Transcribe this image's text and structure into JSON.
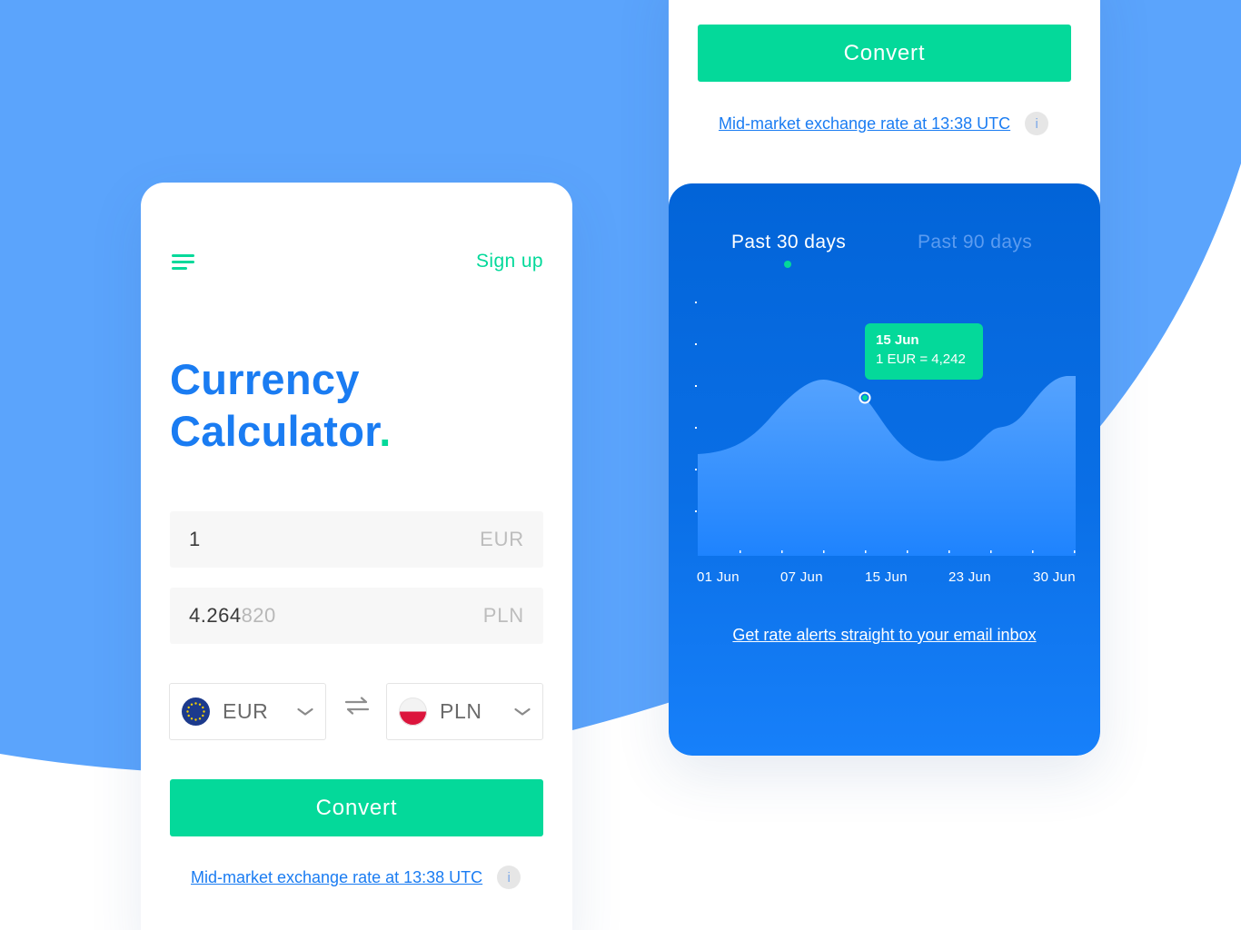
{
  "theme": {
    "accent_green": "#04d99a",
    "brand_blue": "#1a7cf2",
    "background_blue": "#5ba4fc",
    "chart_blue": "#0264d8"
  },
  "left_screen": {
    "menu_icon": "hamburger-menu-icon",
    "signup_label": "Sign up",
    "title_line1": "Currency",
    "title_line2": "Calculator",
    "title_dot": ".",
    "amount_input": {
      "value": "1",
      "currency": "EUR"
    },
    "result_output": {
      "value_bold": "4.264",
      "value_light": "820",
      "currency": "PLN"
    },
    "from_currency": {
      "code": "EUR",
      "flag": "eu-flag-icon"
    },
    "to_currency": {
      "code": "PLN",
      "flag": "poland-flag-icon"
    },
    "swap_icon": "swap-arrows-icon",
    "convert_label": "Convert",
    "rate_text": "Mid-market exchange rate at 13:38 UTC",
    "info_label": "i"
  },
  "right_screen": {
    "convert_label": "Convert",
    "rate_text": "Mid-market exchange rate at 13:38 UTC",
    "info_label": "i",
    "tabs": [
      {
        "label": "Past 30 days",
        "active": true
      },
      {
        "label": "Past 90 days",
        "active": false
      }
    ],
    "tooltip": {
      "date": "15 Jun",
      "value": "1 EUR = 4,242"
    },
    "alert_link": "Get rate alerts straight to your email inbox"
  },
  "chart_data": {
    "type": "area",
    "x": [
      "01 Jun",
      "07 Jun",
      "15 Jun",
      "23 Jun",
      "30 Jun"
    ],
    "highlight": {
      "x": "15 Jun",
      "label": "1 EUR = 4,242"
    },
    "grid": false
  }
}
